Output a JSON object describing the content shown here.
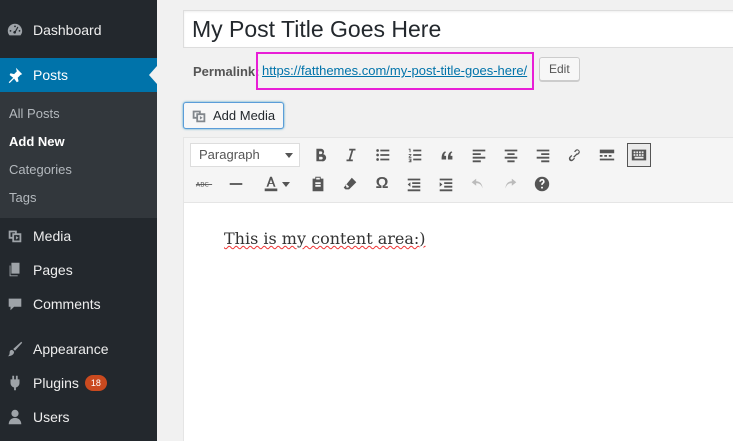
{
  "sidebar": {
    "dashboard": "Dashboard",
    "posts": "Posts",
    "submenu": [
      "All Posts",
      "Add New",
      "Categories",
      "Tags"
    ],
    "media": "Media",
    "pages": "Pages",
    "comments": "Comments",
    "appearance": "Appearance",
    "plugins": "Plugins",
    "plugins_badge": "18",
    "users": "Users"
  },
  "post": {
    "title": "My Post Title Goes Here",
    "permalink_label": "Permalink:",
    "permalink_url": "https://fatthemes.com/my-post-title-goes-here/",
    "edit_label": "Edit"
  },
  "editor": {
    "add_media_label": "Add Media",
    "format_selected": "Paragraph",
    "content_text": "This is my content area:)"
  },
  "colors": {
    "sidebar_bg": "#23282d",
    "active_bg": "#0073aa",
    "highlight_box": "#e81ed6",
    "badge": "#ca4a1f"
  }
}
